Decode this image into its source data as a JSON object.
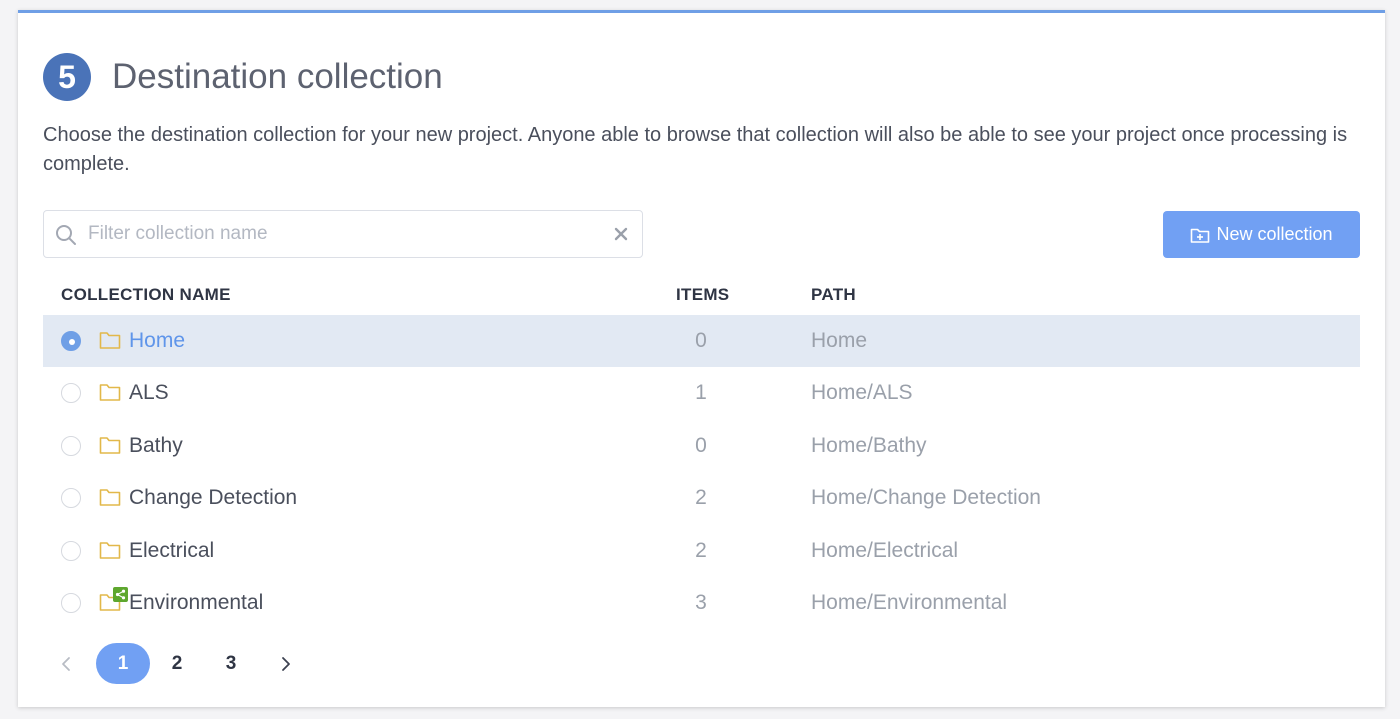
{
  "section": {
    "step_number": "5",
    "title": "Destination collection",
    "description": "Choose the destination collection for your new project. Anyone able to browse that collection will also be able to see your project once processing is complete."
  },
  "search": {
    "value": "",
    "placeholder": "Filter collection name"
  },
  "toolbar": {
    "new_collection_label": "New collection"
  },
  "table": {
    "columns": {
      "name": "COLLECTION NAME",
      "items": "ITEMS",
      "path": "PATH"
    },
    "rows": [
      {
        "name": "Home",
        "items": "0",
        "path": "Home",
        "selected": true,
        "shared": false
      },
      {
        "name": "ALS",
        "items": "1",
        "path": "Home/ALS",
        "selected": false,
        "shared": false
      },
      {
        "name": "Bathy",
        "items": "0",
        "path": "Home/Bathy",
        "selected": false,
        "shared": false
      },
      {
        "name": "Change Detection",
        "items": "2",
        "path": "Home/Change Detection",
        "selected": false,
        "shared": false
      },
      {
        "name": "Electrical",
        "items": "2",
        "path": "Home/Electrical",
        "selected": false,
        "shared": false
      },
      {
        "name": "Environmental",
        "items": "3",
        "path": "Home/Environmental",
        "selected": false,
        "shared": true
      }
    ]
  },
  "pagination": {
    "pages": [
      "1",
      "2",
      "3"
    ],
    "current": "1"
  },
  "colors": {
    "accent": "#71a0f3",
    "step_badge": "#4a73b8",
    "selected_row": "#e2e9f3",
    "folder": "#e2b84a",
    "share_badge": "#5ea72e"
  },
  "icons": {
    "search": "search-icon",
    "clear": "close-icon",
    "new_collection": "folder-plus-icon",
    "folder": "folder-icon",
    "shared": "share-icon",
    "prev": "chevron-left-icon",
    "next": "chevron-right-icon"
  }
}
